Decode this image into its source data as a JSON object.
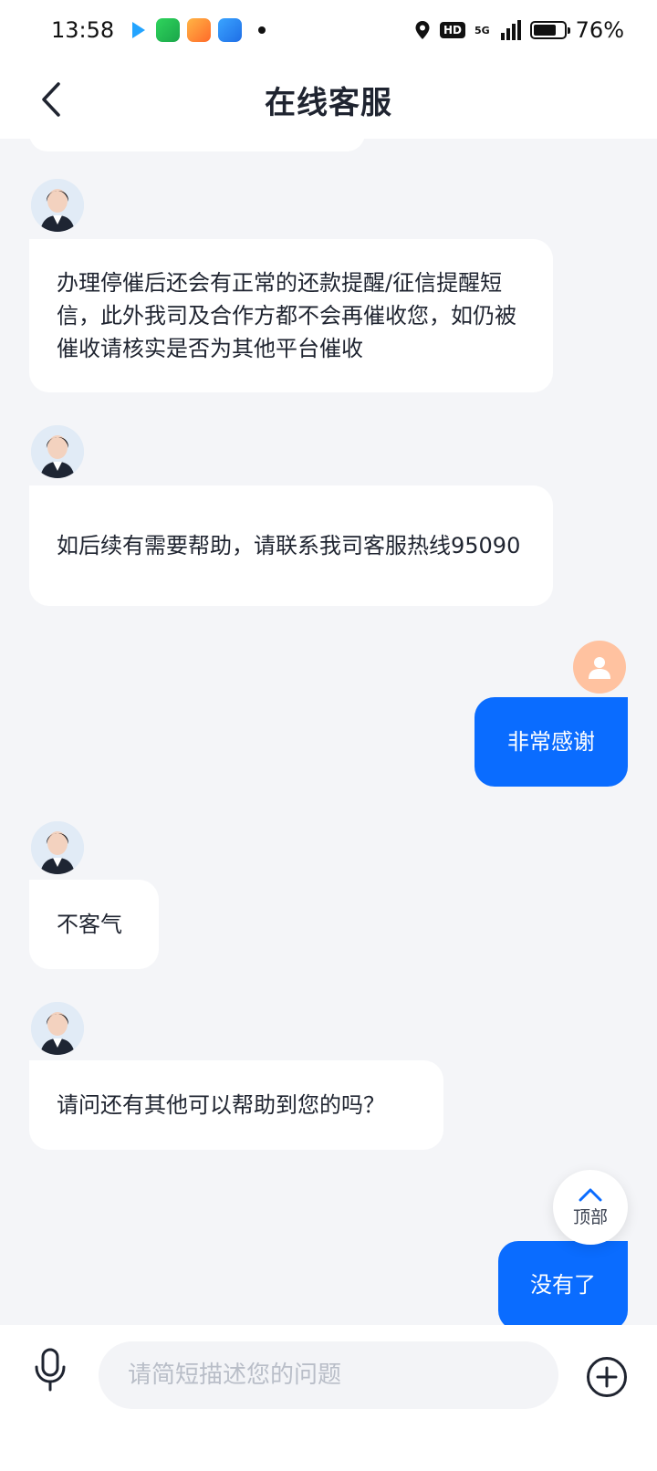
{
  "status": {
    "time": "13:58",
    "hd": "HD",
    "network": "5G",
    "battery_percent": "76%",
    "battery_level": 0.76,
    "apps": [
      "play-icon",
      "iqiyi-icon",
      "video-icon",
      "bird-icon"
    ]
  },
  "header": {
    "title": "在线客服"
  },
  "messages": [
    {
      "sender": "agent",
      "text": "办理停催后还会有正常的还款提醒/征信提醒短信，此外我司及合作方都不会再催收您，如仍被催收请核实是否为其他平台催收"
    },
    {
      "sender": "agent",
      "text": "如后续有需要帮助，请联系我司客服热线95090"
    },
    {
      "sender": "user",
      "text": "非常感谢"
    },
    {
      "sender": "agent",
      "text": "不客气"
    },
    {
      "sender": "agent",
      "text": "请问还有其他可以帮助到您的吗？"
    },
    {
      "sender": "user",
      "text": "没有了"
    }
  ],
  "top_button": {
    "label": "顶部"
  },
  "input": {
    "placeholder": "请简短描述您的问题"
  },
  "colors": {
    "accent": "#0a6cff",
    "background": "#f4f5f8",
    "user_avatar": "#ffc2a0"
  }
}
